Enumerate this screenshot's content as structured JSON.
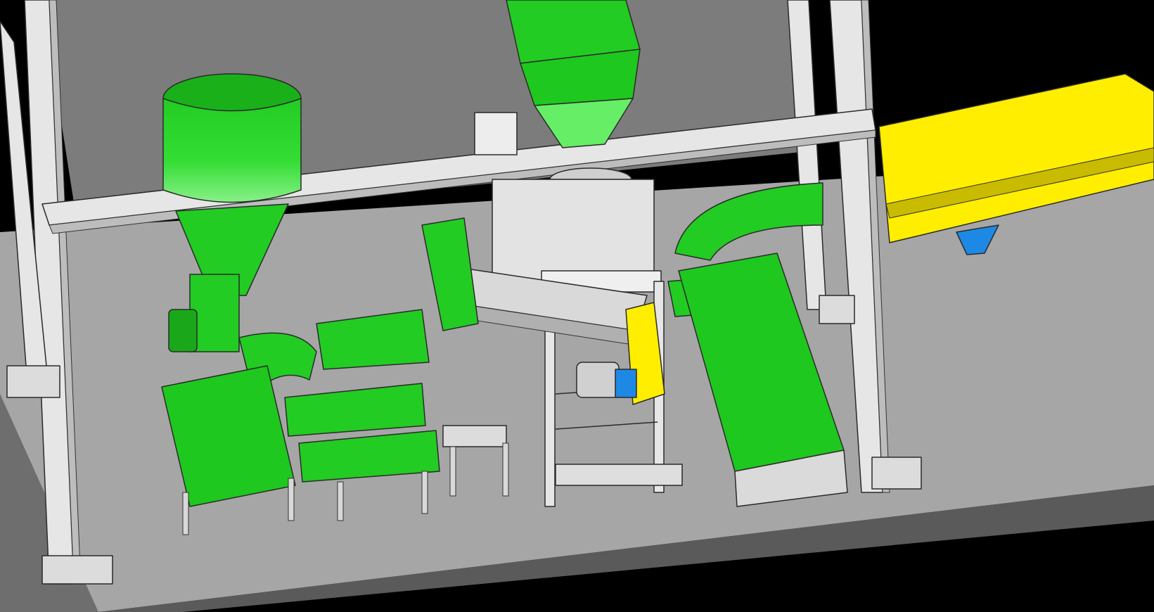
{
  "scene": {
    "description_kind": "3d-cad-render",
    "colors": {
      "background": "#000000",
      "floor": "#a6a6a6",
      "floor_dark": "#7a7a7a",
      "upper_deck": "#7c7c7c",
      "frame": "#e6e6e6",
      "frame_shadow": "#bdbdbd",
      "green": "#22cc22",
      "green_light": "#66ee66",
      "green_dark": "#0f9a0f",
      "yellow": "#ffee00",
      "yellow_dark": "#c9bb00",
      "blue": "#1e88e5",
      "steel": "#d8d8d8"
    },
    "icons": [
      "hopper-icon",
      "conveyor-icon",
      "motor-icon",
      "screw-conveyor-icon"
    ]
  }
}
